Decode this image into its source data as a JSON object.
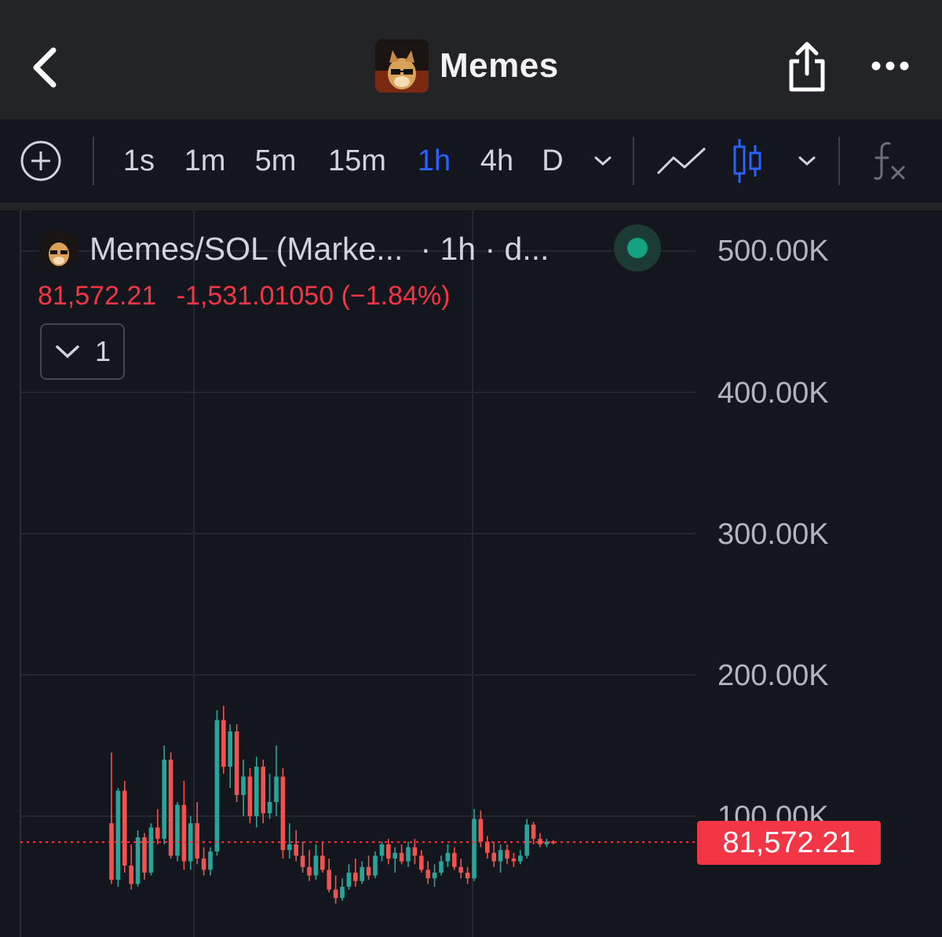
{
  "header": {
    "title": "Memes",
    "back_icon": "chevron-left-icon",
    "share_icon": "share-icon",
    "more_icon": "ellipsis-icon"
  },
  "toolbar": {
    "add_icon": "plus-circle-icon",
    "timeframes": [
      "1s",
      "1m",
      "5m",
      "15m",
      "1h",
      "4h",
      "D"
    ],
    "active_timeframe": "1h",
    "chart_styles": [
      "line-chart-icon",
      "candlestick-icon"
    ],
    "active_style": "candlestick-icon",
    "indicator_icon": "fx-icon"
  },
  "legend": {
    "symbol": "Memes/SOL (Marke...",
    "interval": "· 1h · d...",
    "last_price": "81,572.21",
    "change": "-1,531.01050 (−1.84%)",
    "indicator_count": "1"
  },
  "colors": {
    "up": "#26a69a",
    "down": "#ef5350",
    "accent": "#2962ff",
    "last_price_tag": "#f23645",
    "status_dot": "#13a383"
  },
  "chart_data": {
    "type": "candlestick",
    "title": "Memes/SOL (Marke...",
    "interval": "1h",
    "y_axis_labels": [
      "500.00K",
      "400.00K",
      "300.00K",
      "200.00K",
      "100.00K"
    ],
    "ylim": [
      50000,
      510000
    ],
    "grid": true,
    "last_price": 81572.21,
    "last_price_label": "81,572.21",
    "candles": [
      [
        95000,
        145000,
        52000,
        55000
      ],
      [
        55000,
        120000,
        50000,
        118000
      ],
      [
        118000,
        125000,
        60000,
        65000
      ],
      [
        65000,
        80000,
        48000,
        52000
      ],
      [
        52000,
        90000,
        50000,
        85000
      ],
      [
        85000,
        88000,
        55000,
        60000
      ],
      [
        60000,
        95000,
        58000,
        92000
      ],
      [
        92000,
        105000,
        80000,
        84000
      ],
      [
        84000,
        150000,
        80000,
        140000
      ],
      [
        140000,
        145000,
        70000,
        72000
      ],
      [
        72000,
        110000,
        68000,
        108000
      ],
      [
        108000,
        125000,
        62000,
        68000
      ],
      [
        68000,
        100000,
        62000,
        95000
      ],
      [
        95000,
        110000,
        66000,
        70000
      ],
      [
        70000,
        78000,
        58000,
        62000
      ],
      [
        62000,
        78000,
        58000,
        75000
      ],
      [
        75000,
        175000,
        72000,
        168000
      ],
      [
        168000,
        178000,
        130000,
        135000
      ],
      [
        135000,
        165000,
        120000,
        160000
      ],
      [
        160000,
        165000,
        110000,
        115000
      ],
      [
        115000,
        140000,
        100000,
        128000
      ],
      [
        128000,
        134000,
        95000,
        100000
      ],
      [
        100000,
        142000,
        92000,
        135000
      ],
      [
        135000,
        140000,
        95000,
        102000
      ],
      [
        102000,
        130000,
        98000,
        110000
      ],
      [
        110000,
        150000,
        100000,
        128000
      ],
      [
        128000,
        134000,
        70000,
        76000
      ],
      [
        76000,
        95000,
        70000,
        80000
      ],
      [
        80000,
        90000,
        68000,
        72000
      ],
      [
        72000,
        82000,
        60000,
        64000
      ],
      [
        64000,
        76000,
        54000,
        58000
      ],
      [
        58000,
        80000,
        55000,
        72000
      ],
      [
        72000,
        82000,
        60000,
        62000
      ],
      [
        62000,
        70000,
        46000,
        48000
      ],
      [
        48000,
        58000,
        38000,
        42000
      ],
      [
        42000,
        56000,
        40000,
        50000
      ],
      [
        50000,
        66000,
        48000,
        60000
      ],
      [
        60000,
        70000,
        50000,
        54000
      ],
      [
        54000,
        68000,
        52000,
        64000
      ],
      [
        64000,
        72000,
        55000,
        58000
      ],
      [
        58000,
        75000,
        56000,
        72000
      ],
      [
        72000,
        82000,
        68000,
        80000
      ],
      [
        80000,
        84000,
        66000,
        70000
      ],
      [
        70000,
        78000,
        60000,
        74000
      ],
      [
        74000,
        80000,
        66000,
        68000
      ],
      [
        68000,
        82000,
        64000,
        78000
      ],
      [
        78000,
        84000,
        66000,
        72000
      ],
      [
        72000,
        76000,
        60000,
        62000
      ],
      [
        62000,
        68000,
        52000,
        56000
      ],
      [
        56000,
        66000,
        50000,
        60000
      ],
      [
        60000,
        72000,
        58000,
        68000
      ],
      [
        68000,
        80000,
        64000,
        74000
      ],
      [
        74000,
        78000,
        62000,
        64000
      ],
      [
        64000,
        70000,
        56000,
        60000
      ],
      [
        60000,
        64000,
        52000,
        56000
      ],
      [
        56000,
        105000,
        54000,
        98000
      ],
      [
        98000,
        104000,
        78000,
        82000
      ],
      [
        82000,
        86000,
        70000,
        74000
      ],
      [
        74000,
        82000,
        64000,
        68000
      ],
      [
        68000,
        80000,
        60000,
        76000
      ],
      [
        76000,
        80000,
        66000,
        70000
      ],
      [
        70000,
        74000,
        64000,
        68000
      ],
      [
        68000,
        76000,
        66000,
        72000
      ],
      [
        72000,
        98000,
        70000,
        94000
      ],
      [
        94000,
        96000,
        80000,
        84000
      ],
      [
        84000,
        88000,
        78000,
        80000
      ],
      [
        80000,
        84000,
        78000,
        82000
      ],
      [
        82000,
        83000,
        80000,
        81572
      ]
    ]
  }
}
